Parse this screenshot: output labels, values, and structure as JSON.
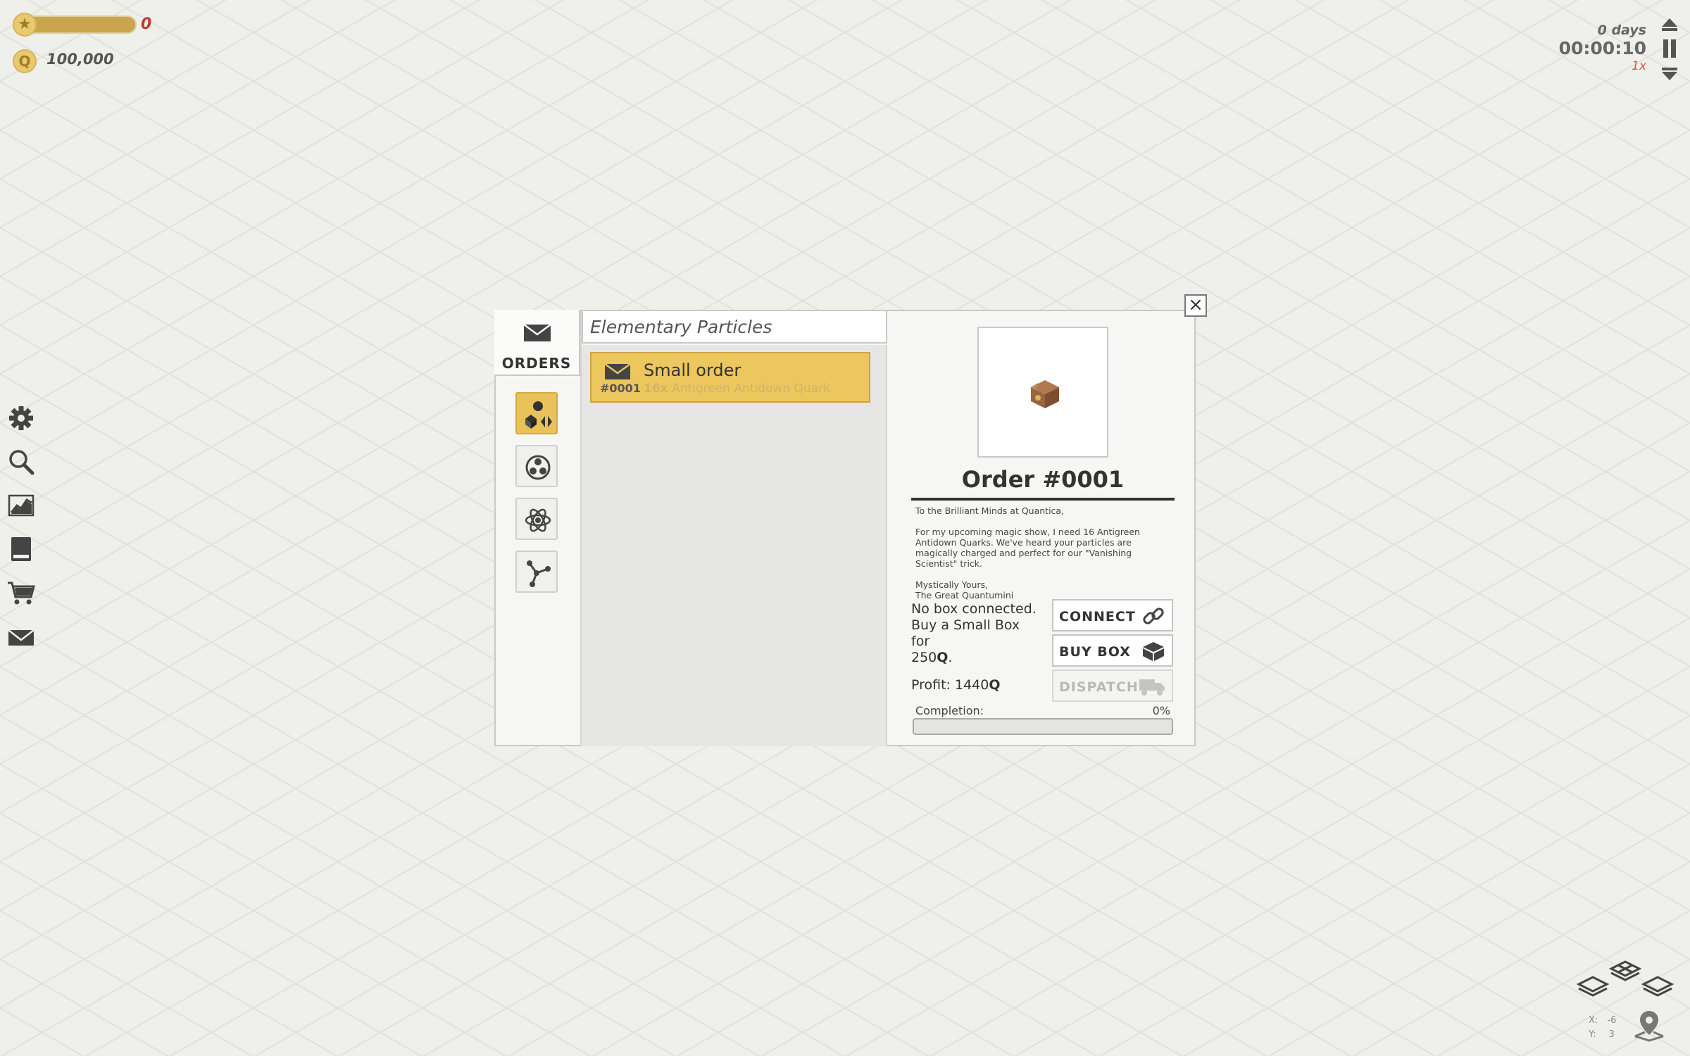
{
  "hud": {
    "reputation": "0",
    "reputation_progress": 1.0,
    "money": "100,000",
    "coin_symbol": "Q",
    "days": "0 days",
    "time": "00:00:10",
    "speed": "1x"
  },
  "toolbar": [
    "gear-icon",
    "search-icon",
    "chart-icon",
    "book-icon",
    "cart-icon",
    "mail-icon"
  ],
  "dialog": {
    "tab_label": "ORDERS",
    "category": "Elementary Particles",
    "order_item": {
      "title": "Small order",
      "id": "#0001",
      "quantity": "16x",
      "particle": "Antigreen Antidown Quark"
    },
    "detail": {
      "title": "Order #0001",
      "letter": {
        "greeting": "To the Brilliant Minds at Quantica,",
        "body": "For my upcoming magic show, I need 16 Antigreen Antidown Quarks. We've heard your particles are magically charged and perfect for our \"Vanishing Scientist\" trick.",
        "closing": "Mystically Yours,",
        "signature": "The Great Quantumini"
      },
      "box_line1": "No box connected.",
      "box_line2": "Buy a Small Box for",
      "box_price": "250",
      "box_currency": "Q",
      "box_period": ".",
      "profit_label": "Profit: 1440",
      "profit_currency": "Q",
      "connect_label": "CONNECT",
      "buy_box_label": "BUY BOX",
      "dispatch_label": "DISPATCH",
      "completion_label": "Completion:",
      "completion_value": "0%",
      "completion_fraction": 0
    }
  },
  "coords": {
    "x_label": "X:",
    "x_value": "-6",
    "y_label": "Y:",
    "y_value": "3"
  },
  "colors": {
    "accent": "#ecc75e",
    "warning": "#d9534f"
  }
}
